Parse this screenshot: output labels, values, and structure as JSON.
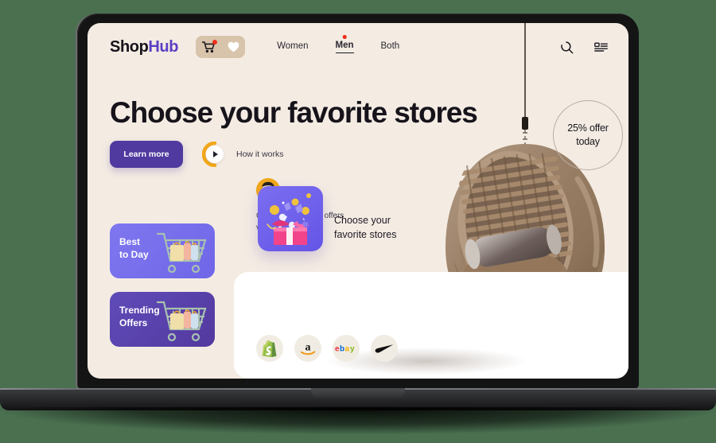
{
  "page": {
    "background_color": "#4a7050",
    "screen_background": "#f4ece3",
    "panel_background": "#ffffff",
    "accent_purple": "#50399f",
    "accent_yellow": "#f2a81b",
    "badge_red": "#f0301c"
  },
  "nav": {
    "logo_main": "Shop",
    "logo_accent": "Hub",
    "cart_icon": "shopping-cart-icon",
    "wishlist_icon": "heart-icon",
    "links": [
      {
        "label": "Women",
        "active": false,
        "dot": false
      },
      {
        "label": "Men",
        "active": true,
        "dot": true
      },
      {
        "label": "Both",
        "active": false,
        "dot": false
      }
    ],
    "right_icons": [
      {
        "name": "search-icon"
      },
      {
        "name": "list-view-icon"
      }
    ]
  },
  "hero": {
    "title": "Choose your favorite stores",
    "learn_more_label": "Learn more",
    "how_it_works_label": "How it works",
    "play_icon": "play-icon"
  },
  "promo": {
    "avatar_icon": "user-avatar",
    "line1": "On elegance suits. offers",
    "line2": "valid upto apr 24th."
  },
  "offer_cards": [
    {
      "line1": "Best",
      "line2": "to Day",
      "color": "#7f77ef",
      "art": "shopping-cart-illustration"
    },
    {
      "line1": "Trending",
      "line2": "Offers",
      "color": "#53399f",
      "art": "shopping-cart-illustration"
    }
  ],
  "panel": {
    "gift_card_icon": "gift-box-illustration",
    "choose_line1": "Choose your",
    "choose_line2": "favorite stores",
    "brands": [
      {
        "name": "shopify-logo",
        "label": "Shopify"
      },
      {
        "name": "amazon-logo",
        "label": "amazon"
      },
      {
        "name": "ebay-logo",
        "label": "ebay"
      },
      {
        "name": "nike-logo",
        "label": "Nike"
      }
    ]
  },
  "badge": {
    "line1": "25% offer",
    "line2": "today"
  },
  "product": {
    "name": "hanging-egg-chair"
  }
}
